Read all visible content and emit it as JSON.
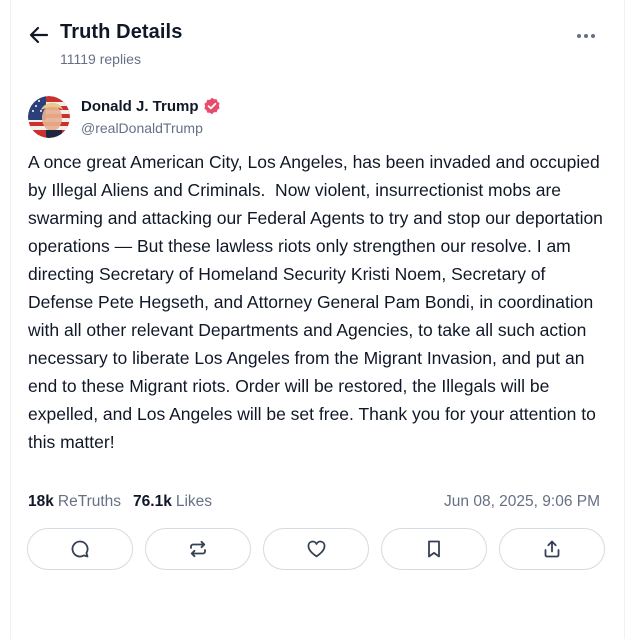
{
  "header": {
    "title": "Truth Details",
    "replies": "11119 replies",
    "icons": {
      "back": "arrow-left-icon",
      "more": "more-horizontal-icon"
    }
  },
  "author": {
    "name": "Donald J. Trump",
    "handle": "@realDonaldTrump",
    "verified": true,
    "verified_color": "#e94b6b"
  },
  "post": {
    "text": "A once great American City, Los Angeles, has been invaded and occupied by Illegal Aliens and Criminals.  Now violent, insurrectionist mobs are swarming and attacking our Federal Agents to try and stop our deportation operations — But these lawless riots only strengthen our resolve. I am directing Secretary of Homeland Security Kristi Noem, Secretary of Defense Pete Hegseth, and Attorney General Pam Bondi, in coordination with all other relevant Departments and Agencies, to take all such action necessary to liberate Los Angeles from the Migrant Invasion, and put an end to these Migrant riots. Order will be restored, the Illegals will be expelled, and Los Angeles will be set free. Thank you for your attention to this matter!"
  },
  "stats": {
    "retruths_count": "18k",
    "retruths_label": "ReTruths",
    "likes_count": "76.1k",
    "likes_label": "Likes",
    "timestamp": "Jun 08, 2025, 9:06 PM"
  },
  "actions": [
    {
      "icon": "reply-icon"
    },
    {
      "icon": "retruth-icon"
    },
    {
      "icon": "like-heart-icon"
    },
    {
      "icon": "bookmark-icon"
    },
    {
      "icon": "share-icon"
    }
  ],
  "colors": {
    "primary_text": "#101828",
    "secondary_text": "#667085",
    "border": "#d6dae1",
    "icon": "#344054"
  }
}
